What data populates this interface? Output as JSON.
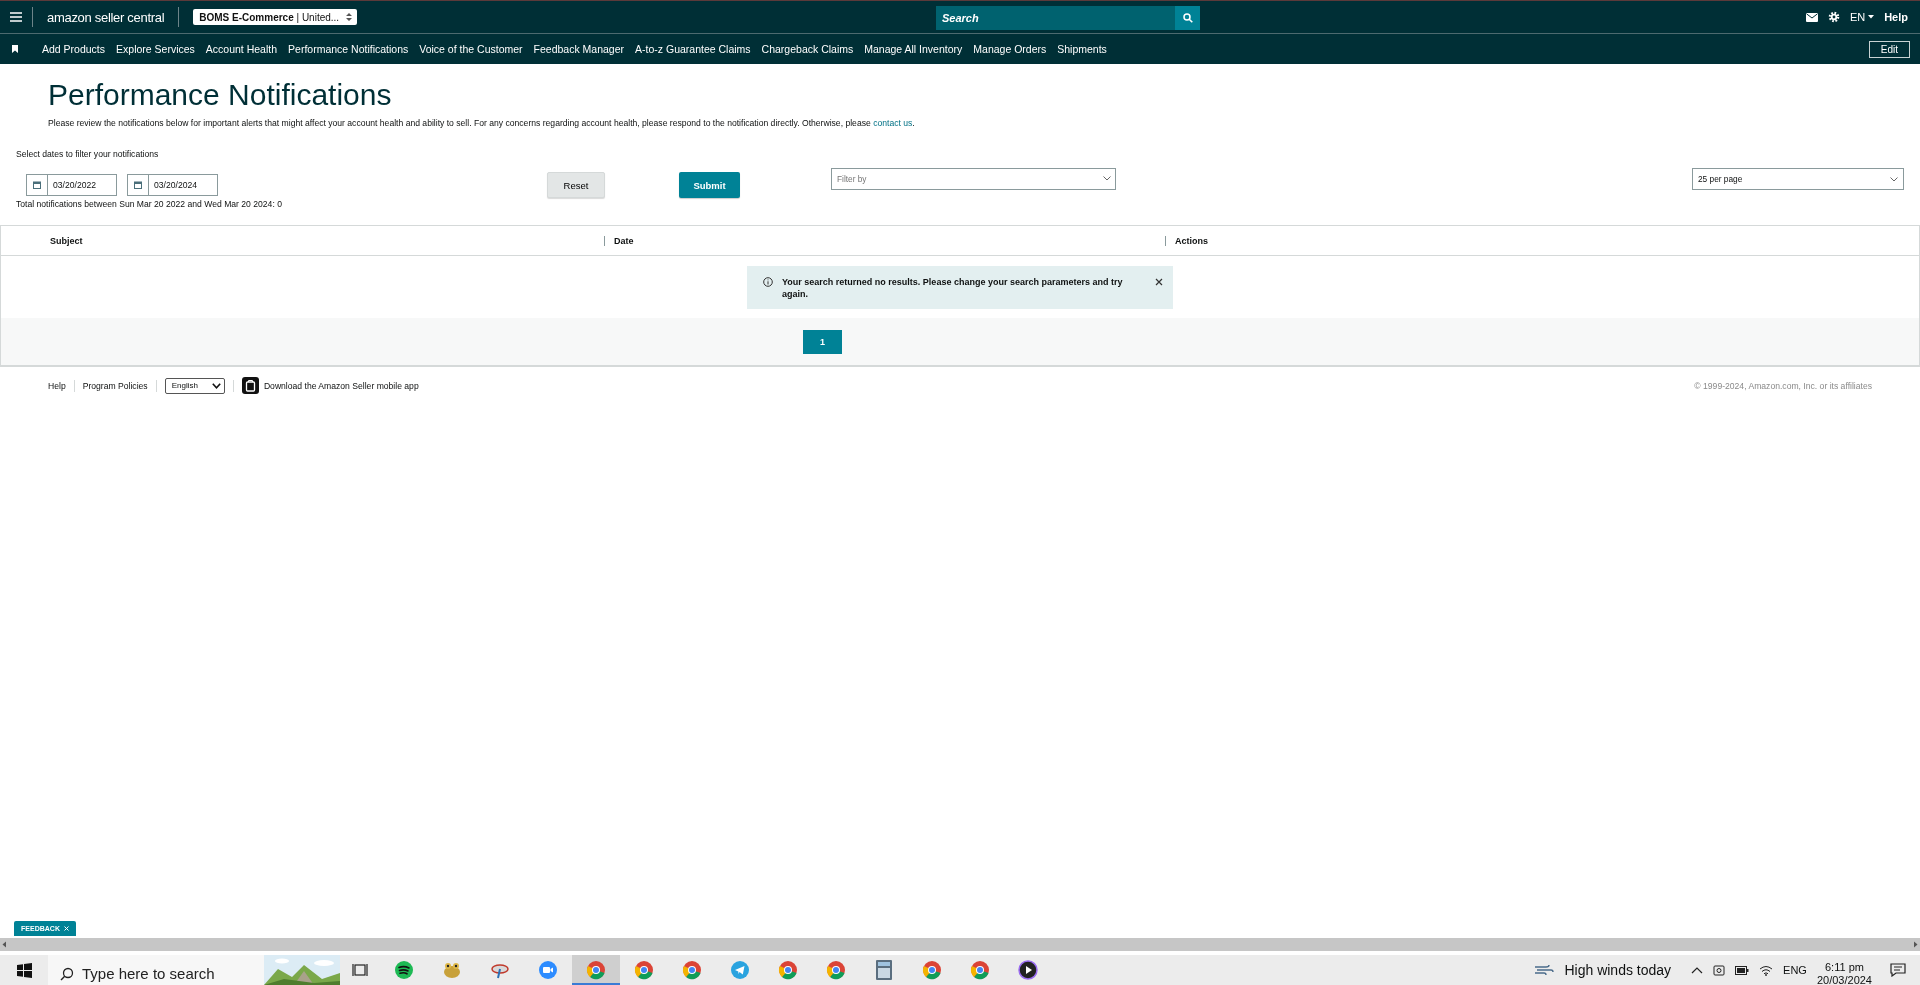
{
  "top_bar": {
    "logo": "amazon seller central",
    "store_selector": "**BOMS E-Commerce** | United...",
    "search": {
      "placeholder": "Search"
    },
    "language": "EN",
    "help": "Help"
  },
  "nav": {
    "items": [
      "Add Products",
      "Explore Services",
      "Account Health",
      "Performance Notifications",
      "Voice of the Customer",
      "Feedback Manager",
      "A-to-z Guarantee Claims",
      "Chargeback Claims",
      "Manage All Inventory",
      "Manage Orders",
      "Shipments"
    ],
    "edit": "Edit"
  },
  "page": {
    "title": "Performance Notifications",
    "intro": "Please review the notifications below for important alerts that might affect your account health and ability to sell. For any concerns regarding account health, please respond to the notification directly. Otherwise, please ",
    "intro_link": "contact us",
    "intro_end": "."
  },
  "filters": {
    "date_label": "Select dates to filter your notifications",
    "start_date": "03/20/2022",
    "end_date": "03/20/2024",
    "total": "Total notifications between Sun Mar 20 2022 and Wed Mar 20 2024: 0",
    "reset": "Reset",
    "submit": "Submit",
    "filter": {
      "placeholder": "Filter by"
    },
    "per_page": "25 per page"
  },
  "table": {
    "columns": [
      "Subject",
      "Date",
      "Actions"
    ],
    "alert": "Your search returned no results. Please change your search parameters and try again."
  },
  "pagination": [
    {
      "label": "1",
      "selected": true
    }
  ],
  "footer": {
    "links": [
      "Help",
      "Program Policies"
    ],
    "language": "English",
    "app_promo": "Download the Amazon Seller mobile app",
    "copyright": "© 1999-2024, Amazon.com, Inc. or its affiliates"
  },
  "feedback_tab": "FEEDBACK",
  "taskbar": {
    "search": {
      "placeholder": "Type here to search"
    },
    "apps": [
      {
        "selected": false
      },
      {
        "selected": false
      },
      {
        "selected": false
      },
      {
        "selected": false
      },
      {
        "selected": true
      },
      {
        "selected": false
      },
      {
        "selected": false
      },
      {
        "selected": false
      },
      {
        "selected": false
      },
      {
        "selected": false
      },
      {
        "selected": false
      },
      {
        "selected": false
      },
      {
        "selected": false
      },
      {
        "selected": false
      }
    ],
    "weather": "High winds today",
    "language": "ENG",
    "time": "6:11 pm",
    "date": "20/03/2024"
  }
}
